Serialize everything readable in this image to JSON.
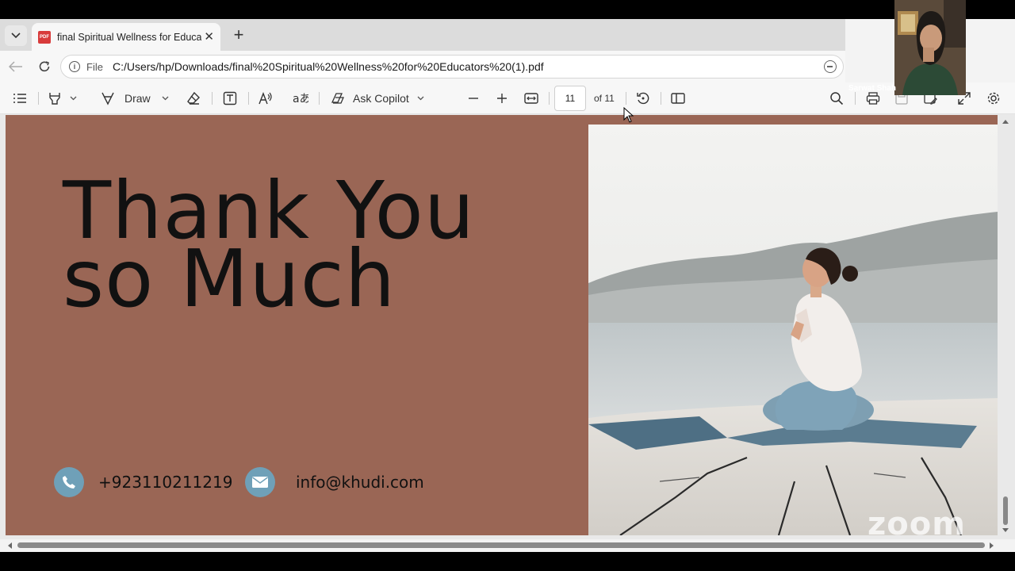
{
  "browser": {
    "tab_title": "final Spiritual Wellness for Educato",
    "tab_close": "✕",
    "new_tab": "+",
    "address_scheme": "File",
    "url": "C:/Users/hp/Downloads/final%20Spiritual%20Wellness%20for%20Educators%20(1).pdf"
  },
  "toolbar": {
    "draw_label": "Draw",
    "copilot_label": "Ask Copilot",
    "current_page": "11",
    "page_count": "of 11"
  },
  "slide": {
    "heading_line1": "Thank You",
    "heading_line2": "so Much",
    "phone": "+923110211219",
    "email": "info@khudi.com",
    "background_color": "#9a6655",
    "icon_color": "#6fa0b8"
  },
  "zoom": {
    "participant_name": "Sarwat Shah",
    "watermark": "zoom"
  },
  "icons": [
    "chevron-down-icon",
    "pdf-icon",
    "close-icon",
    "plus-icon",
    "back-arrow-icon",
    "refresh-icon",
    "info-icon",
    "zoom-out-icon",
    "contents-icon",
    "highlight-icon",
    "draw-icon",
    "eraser-icon",
    "text-box-icon",
    "read-aloud-icon",
    "translate-icon",
    "copilot-icon",
    "minus-icon",
    "fit-width-icon",
    "rotate-icon",
    "page-view-icon",
    "search-icon",
    "print-icon",
    "save-icon",
    "save-as-icon",
    "fullscreen-icon",
    "settings-icon",
    "phone-icon",
    "mail-icon",
    "cursor-icon"
  ]
}
